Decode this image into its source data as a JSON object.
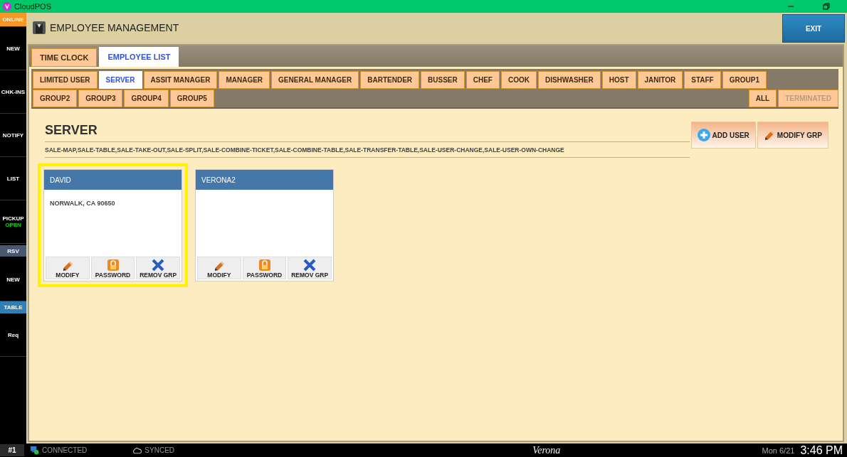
{
  "window": {
    "title": "CloudPOS"
  },
  "sidebar": {
    "items": [
      {
        "label": "ONLINE",
        "kind": "status"
      },
      {
        "label": "NEW",
        "kind": "item"
      },
      {
        "label": "CHK-INS",
        "kind": "item"
      },
      {
        "label": "NOTIFY",
        "kind": "item"
      },
      {
        "label": "LIST",
        "kind": "item"
      },
      {
        "label": "PICKUP",
        "sub": "OPEN",
        "kind": "item"
      },
      {
        "label": "RSV",
        "kind": "band"
      },
      {
        "label": "NEW",
        "kind": "item"
      },
      {
        "label": "TABLE",
        "kind": "active-band"
      },
      {
        "label": "Req",
        "kind": "item"
      }
    ]
  },
  "header": {
    "title": "EMPLOYEE MANAGEMENT",
    "exit": "EXIT"
  },
  "tabs": [
    {
      "label": "TIME CLOCK",
      "selected": false
    },
    {
      "label": "EMPLOYEE LIST",
      "selected": true
    }
  ],
  "groups": {
    "row_1": [
      {
        "label": "LIMITED USER",
        "selected": false
      },
      {
        "label": "SERVER",
        "selected": true
      },
      {
        "label": "ASSIT MANAGER",
        "selected": false
      },
      {
        "label": "MANAGER",
        "selected": false
      },
      {
        "label": "GENERAL MANAGER",
        "selected": false
      },
      {
        "label": "BARTENDER",
        "selected": false
      },
      {
        "label": "BUSSER",
        "selected": false
      },
      {
        "label": "CHEF",
        "selected": false
      },
      {
        "label": "COOK",
        "selected": false
      },
      {
        "label": "DISHWASHER",
        "selected": false
      },
      {
        "label": "HOST",
        "selected": false
      },
      {
        "label": "JANITOR",
        "selected": false
      },
      {
        "label": "STAFF",
        "selected": false
      },
      {
        "label": "GROUP1",
        "selected": false
      }
    ],
    "row_2": [
      {
        "label": "GROUP2",
        "selected": false
      },
      {
        "label": "GROUP3",
        "selected": false
      },
      {
        "label": "GROUP4",
        "selected": false
      },
      {
        "label": "GROUP5",
        "selected": false
      }
    ],
    "filters": [
      {
        "label": "ALL",
        "disabled": false
      },
      {
        "label": "TERMINATED",
        "disabled": true
      }
    ]
  },
  "group_detail": {
    "title": "SERVER",
    "permissions": "SALE-MAP,SALE-TABLE,SALE-TAKE-OUT,SALE-SPLIT,SALE-COMBINE-TICKET,SALE-COMBINE-TABLE,SALE-TRANSFER-TABLE,SALE-USER-CHANGE,SALE-USER-OWN-CHANGE",
    "buttons": [
      {
        "label": "ADD USER",
        "kind": "add"
      },
      {
        "label": "MODIFY GRP",
        "kind": "modify"
      }
    ]
  },
  "employees": [
    {
      "name": "DAVID",
      "address": "NORWALK, CA 90650",
      "selected": true,
      "actions": [
        {
          "label": "MODIFY",
          "kind": "modify"
        },
        {
          "label": "PASSWORD",
          "kind": "password"
        },
        {
          "label": "REMOV GRP",
          "kind": "remove"
        }
      ]
    },
    {
      "name": "VERONA2",
      "selected": false,
      "actions": [
        {
          "label": "MODIFY",
          "kind": "modify"
        },
        {
          "label": "PASSWORD",
          "kind": "password"
        },
        {
          "label": "REMOV GRP",
          "kind": "remove"
        }
      ]
    }
  ],
  "status_bar": {
    "terminal": "#1",
    "connection": "CONNECTED",
    "sync": "SYNCED",
    "store": "Verona",
    "date": "Mon 6/21",
    "time": "3:46 PM"
  }
}
